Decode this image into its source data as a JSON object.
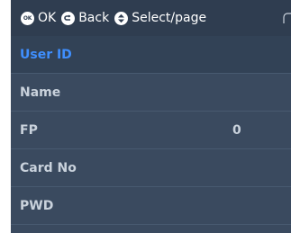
{
  "header": {
    "hints": [
      {
        "key": "OK",
        "label": "OK"
      },
      {
        "key": "back-icon",
        "label": "Back"
      },
      {
        "key": "updown-icon",
        "label": "Select/page"
      }
    ]
  },
  "menu": {
    "items": [
      {
        "label": "User ID",
        "value": "",
        "selected": true
      },
      {
        "label": "Name",
        "value": ""
      },
      {
        "label": "FP",
        "value": "0"
      },
      {
        "label": "Card No",
        "value": ""
      },
      {
        "label": "PWD",
        "value": ""
      }
    ]
  },
  "colors": {
    "header_bg": "#2f3d50",
    "row_bg": "#3a4a5f",
    "selected_text": "#3f8fff",
    "text": "#c9d2dc"
  }
}
